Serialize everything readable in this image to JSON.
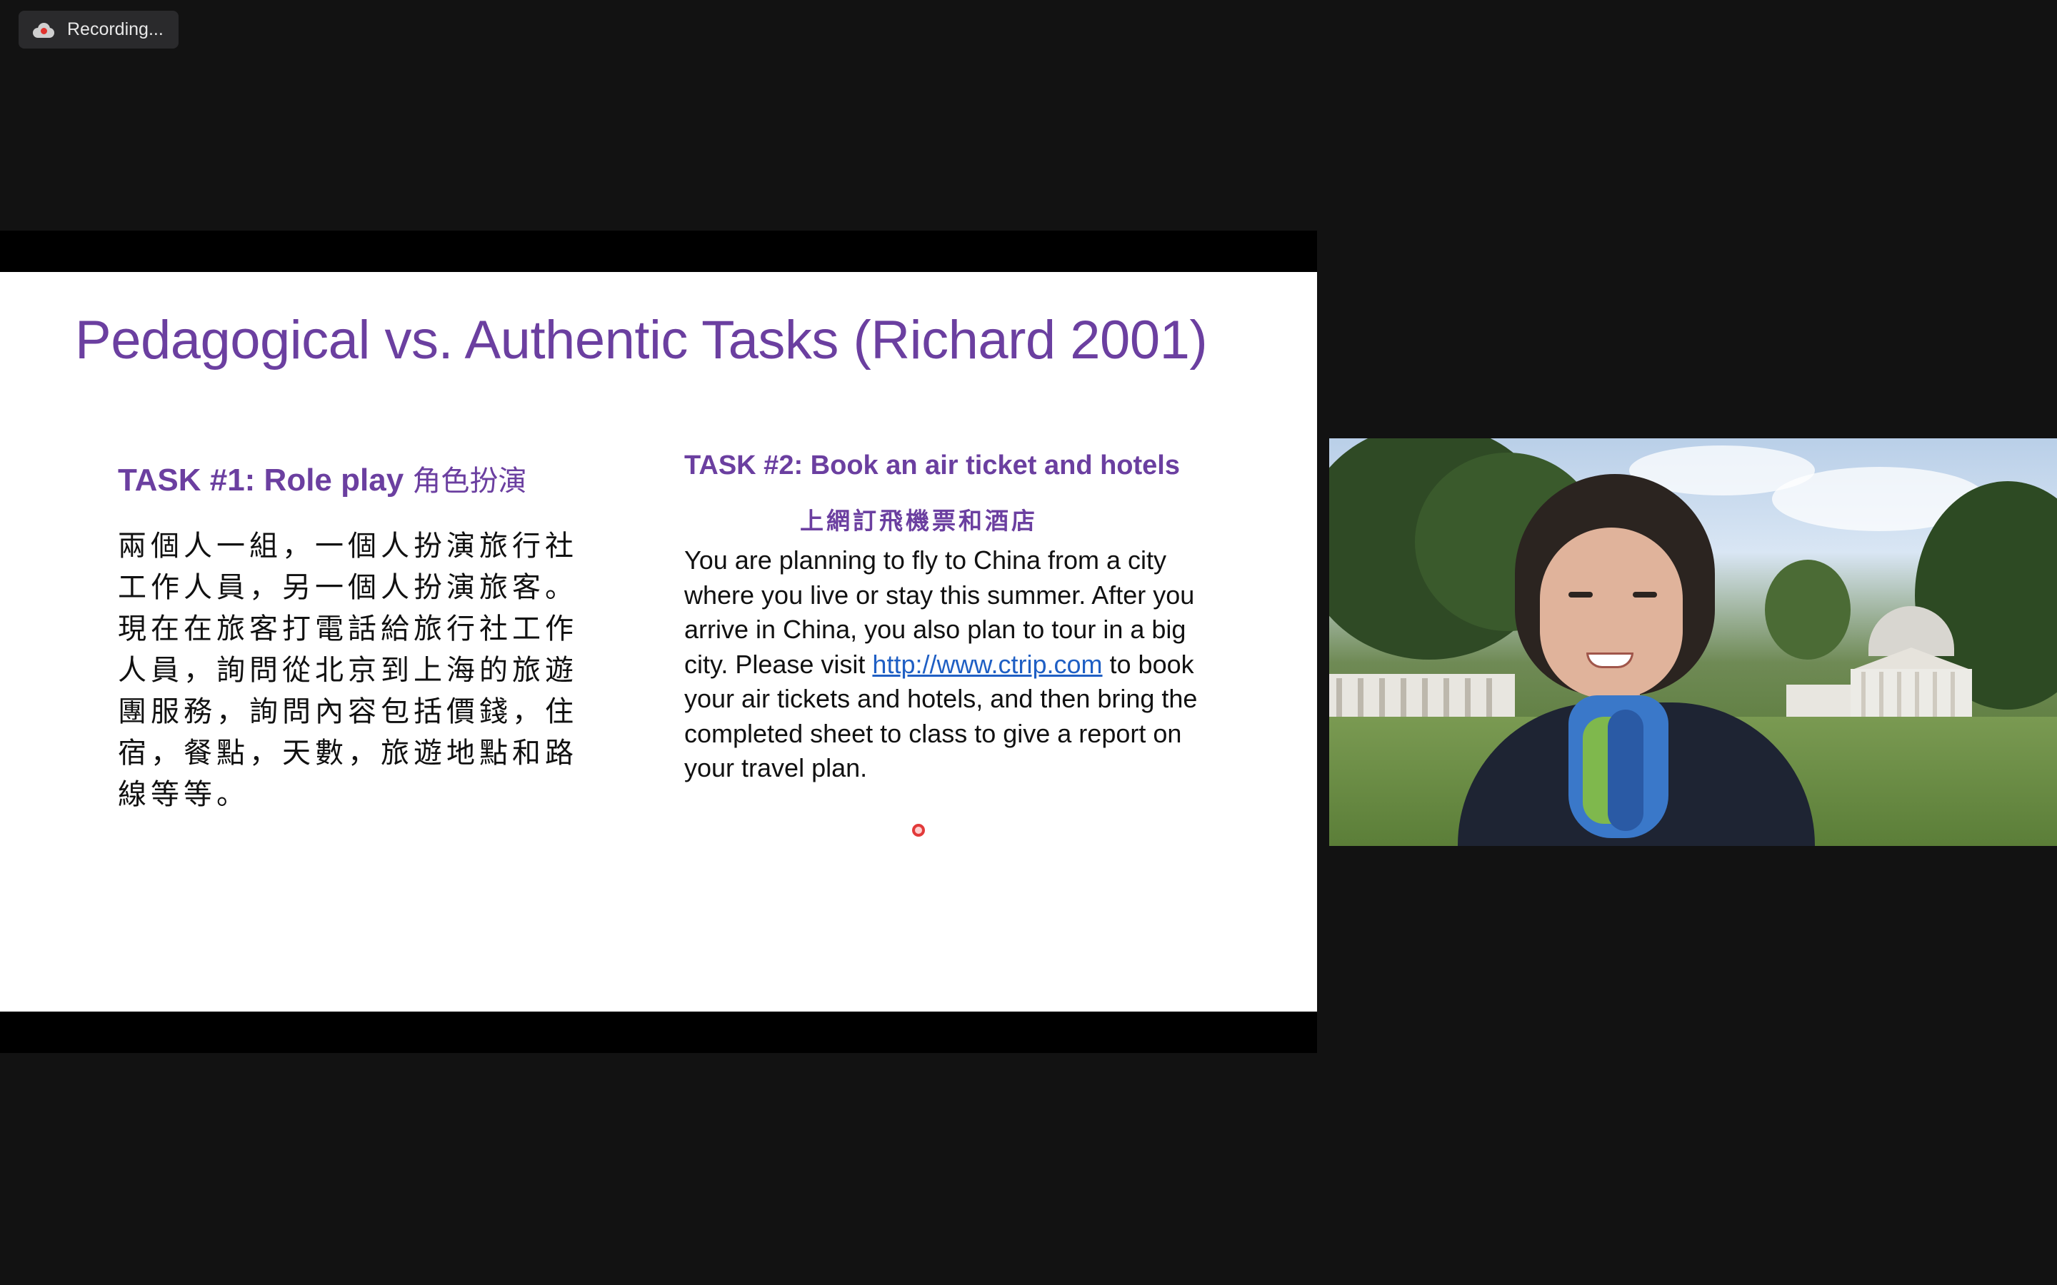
{
  "recording": {
    "label": "Recording..."
  },
  "slide": {
    "title": "Pedagogical vs. Authentic Tasks (Richard 2001)",
    "task1": {
      "heading_en": "TASK #1: Role play",
      "heading_cn": "角色扮演",
      "body_lines": [
        "兩個人一組，一個人扮演旅行社",
        "工作人員，另一個人扮演旅客。",
        "現在在旅客打電話給旅行社工作",
        "人員，詢問從北京到上海的旅遊",
        "團服務，詢問內容包括價錢，住",
        "宿，餐點，天數，旅遊地點和路",
        "線等等。"
      ]
    },
    "task2": {
      "heading": "TASK #2: Book an air ticket and hotels",
      "subheading_cn": "上網訂飛機票和酒店",
      "body_before_link": "You are planning to fly to China from a city where you live or stay this summer. After you arrive in China, you also plan to tour in a big city. Please visit ",
      "link_text": "http://www.ctrip.com",
      "body_after_link": " to book your air tickets and hotels, and then bring the completed sheet to class to give a report on your travel plan."
    }
  },
  "colors": {
    "background": "#121212",
    "title_purple": "#6b3fa0",
    "link_blue": "#1f5fc4",
    "recording_dot": "#e0332e"
  }
}
